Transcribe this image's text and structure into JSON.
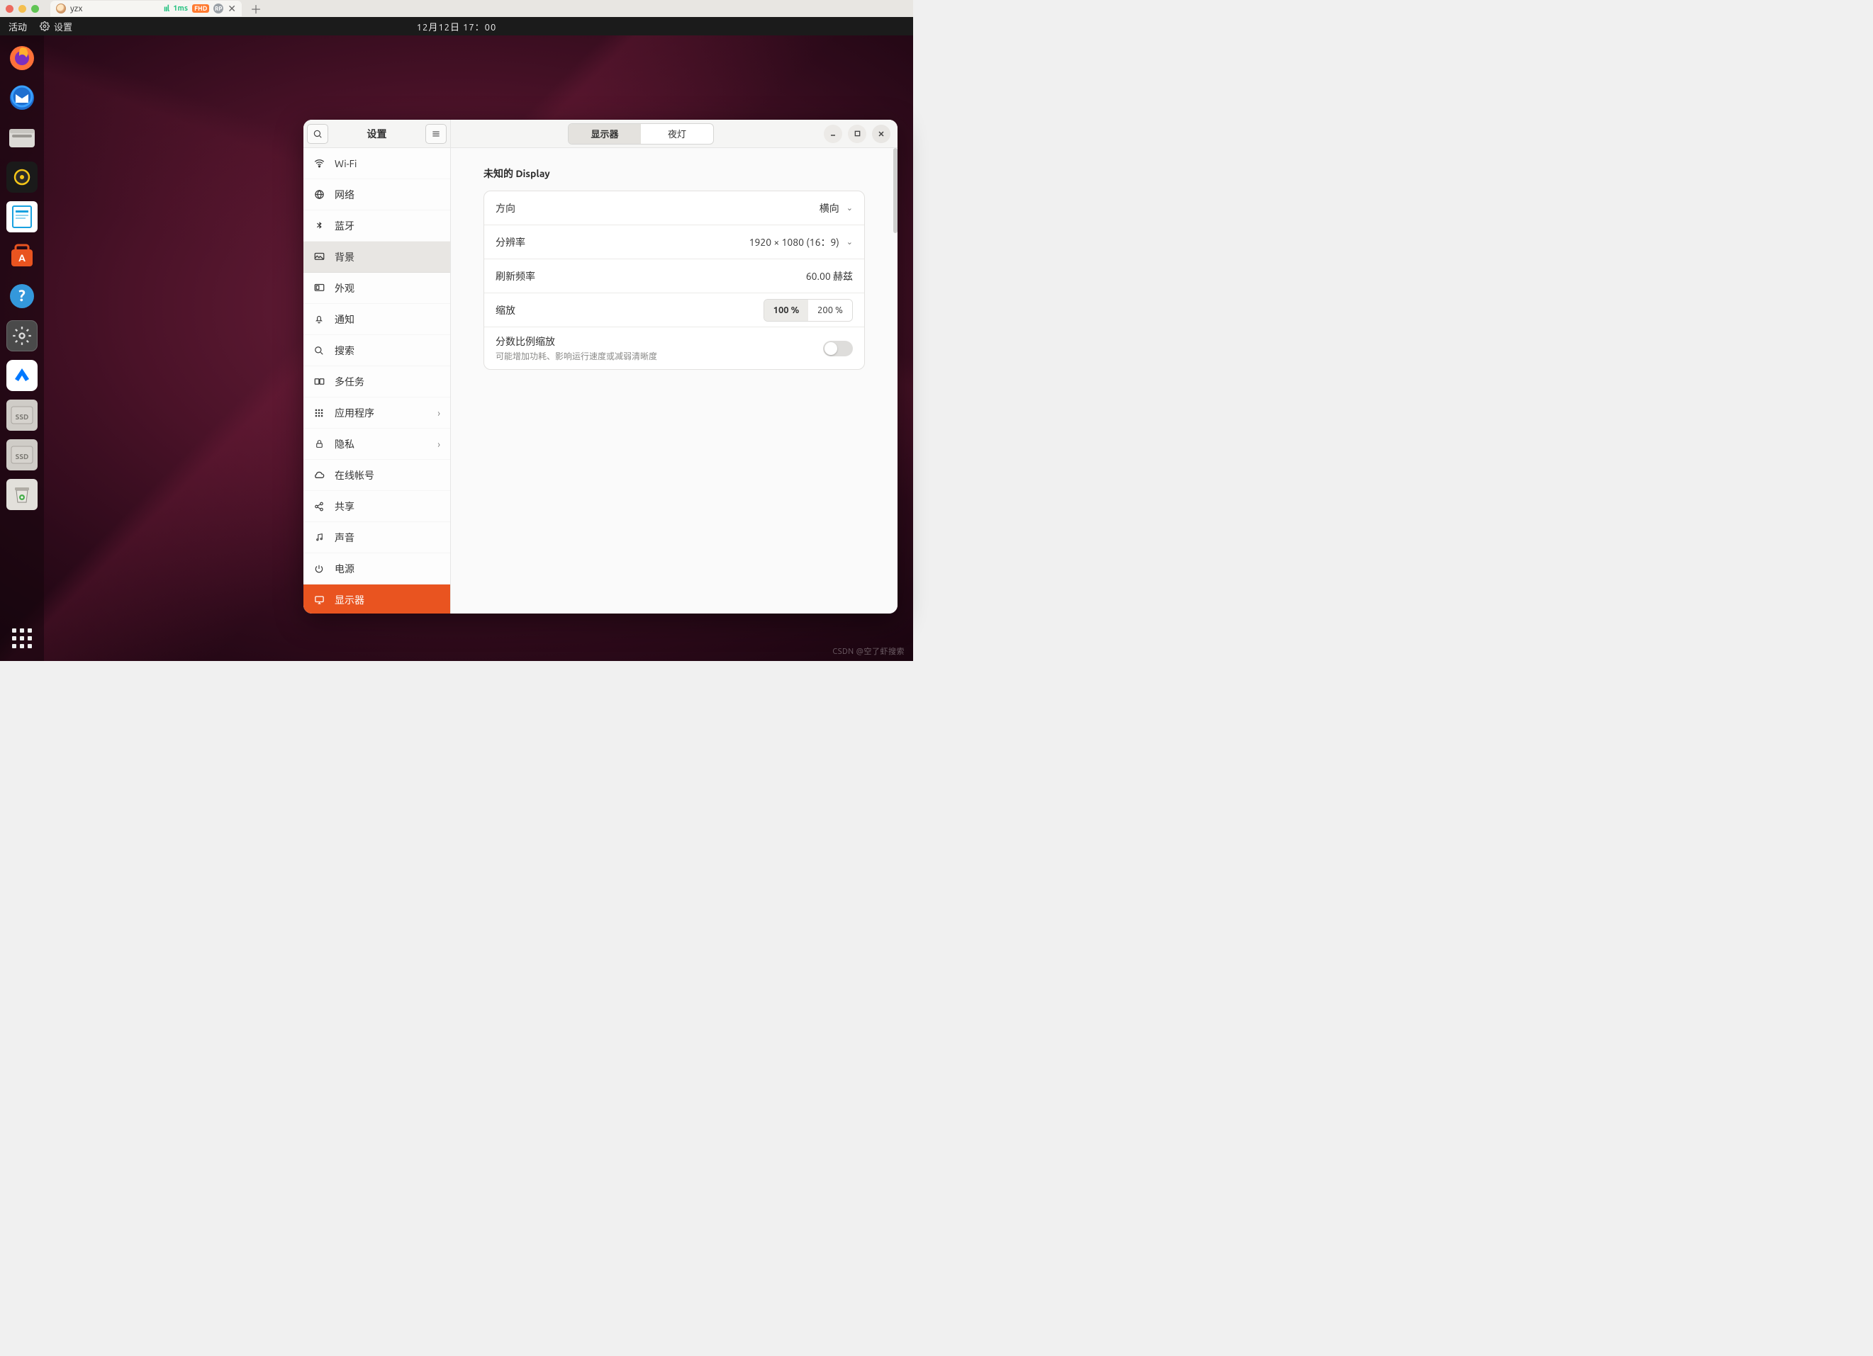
{
  "browser": {
    "tab_title": "yzx",
    "latency": "1ms",
    "badges": {
      "fhd": "FHD",
      "rp": "RP"
    }
  },
  "topbar": {
    "activities": "活动",
    "app_name": "设置",
    "datetime": "12月12日  17：00"
  },
  "dock": {
    "items": [
      "firefox",
      "thunderbird",
      "files",
      "rhythmbox",
      "libreoffice-writer",
      "software",
      "help",
      "settings",
      "todesk",
      "ssd-1",
      "ssd-2",
      "trash"
    ]
  },
  "settings": {
    "title": "设置",
    "sidebar": [
      {
        "icon": "wifi",
        "label": "Wi-Fi"
      },
      {
        "icon": "globe",
        "label": "网络"
      },
      {
        "icon": "bluetooth",
        "label": "蓝牙"
      },
      {
        "icon": "background",
        "label": "背景",
        "selected": true
      },
      {
        "icon": "appearance",
        "label": "外观"
      },
      {
        "icon": "bell",
        "label": "通知"
      },
      {
        "icon": "search",
        "label": "搜索"
      },
      {
        "icon": "multitask",
        "label": "多任务"
      },
      {
        "icon": "apps",
        "label": "应用程序",
        "chevron": true
      },
      {
        "icon": "lock",
        "label": "隐私",
        "chevron": true
      },
      {
        "icon": "cloud",
        "label": "在线帐号"
      },
      {
        "icon": "share",
        "label": "共享"
      },
      {
        "icon": "music",
        "label": "声音"
      },
      {
        "icon": "power",
        "label": "电源"
      },
      {
        "icon": "display",
        "label": "显示器",
        "active": true
      }
    ],
    "tabs": {
      "displays": "显示器",
      "nightlight": "夜灯"
    },
    "section_title": "未知的 Display",
    "rows": {
      "orientation": {
        "label": "方向",
        "value": "横向"
      },
      "resolution": {
        "label": "分辨率",
        "value": "1920 × 1080 (16：9)"
      },
      "refresh": {
        "label": "刷新频率",
        "value": "60.00 赫兹"
      },
      "scale": {
        "label": "缩放",
        "opt100": "100 %",
        "opt200": "200 %"
      },
      "fractional": {
        "label": "分数比例缩放",
        "sub": "可能增加功耗、影响运行速度或减弱清晰度"
      }
    }
  },
  "watermark": "CSDN @空了虾搜索"
}
